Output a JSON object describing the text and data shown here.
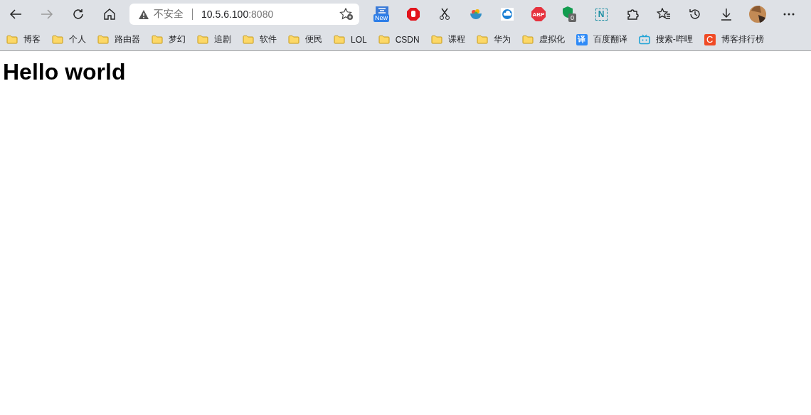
{
  "toolbar": {
    "back_disabled": false,
    "forward_disabled": true,
    "address": {
      "security": "不安全",
      "host": "10.5.6.100",
      "port": ":8080"
    },
    "extensions": [
      {
        "kind": "new",
        "text": "New"
      },
      {
        "kind": "stop"
      },
      {
        "kind": "scissors"
      },
      {
        "kind": "bowl"
      },
      {
        "kind": "cloud"
      },
      {
        "kind": "abp",
        "text": "ABP"
      },
      {
        "kind": "shield",
        "text": "0"
      },
      {
        "kind": "n",
        "text": "N"
      },
      {
        "kind": "puzzle"
      }
    ]
  },
  "bookmarks": [
    {
      "kind": "folder",
      "label": "博客"
    },
    {
      "kind": "folder",
      "label": "个人"
    },
    {
      "kind": "folder",
      "label": "路由器"
    },
    {
      "kind": "folder",
      "label": "梦幻"
    },
    {
      "kind": "folder",
      "label": "追剧"
    },
    {
      "kind": "folder",
      "label": "软件"
    },
    {
      "kind": "folder",
      "label": "便民"
    },
    {
      "kind": "folder",
      "label": "LOL"
    },
    {
      "kind": "folder",
      "label": "CSDN"
    },
    {
      "kind": "folder",
      "label": "课程"
    },
    {
      "kind": "folder",
      "label": "华为"
    },
    {
      "kind": "folder",
      "label": "虚拟化"
    },
    {
      "kind": "translate",
      "label": "百度翻译",
      "icon_text": "译"
    },
    {
      "kind": "tv",
      "label": "搜索-哔哩"
    },
    {
      "kind": "c",
      "label": "博客排行榜",
      "icon_text": "C"
    }
  ],
  "page": {
    "heading": "Hello world"
  }
}
